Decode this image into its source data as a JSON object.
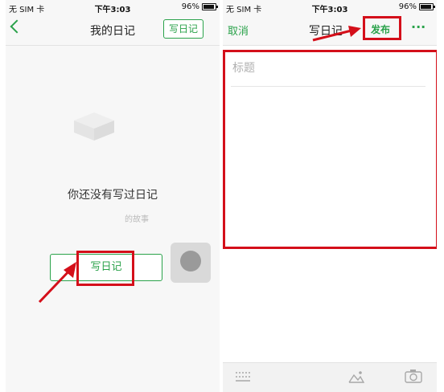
{
  "status": {
    "carrier": "无 SIM 卡",
    "time": "下午3:03",
    "battery": "96%",
    "battery_level": 0.96
  },
  "left_screen": {
    "nav": {
      "title": "我的日记",
      "write_button": "写日记"
    },
    "empty_message": "你还没有写过日记",
    "faded_text": "的故事",
    "write_button": "写日记"
  },
  "right_screen": {
    "nav": {
      "cancel": "取消",
      "title": "写日记",
      "publish": "发布",
      "more": "···"
    },
    "title_placeholder": "标题"
  },
  "colors": {
    "accent_green": "#2aa24a",
    "highlight_red": "#d40f1a"
  }
}
